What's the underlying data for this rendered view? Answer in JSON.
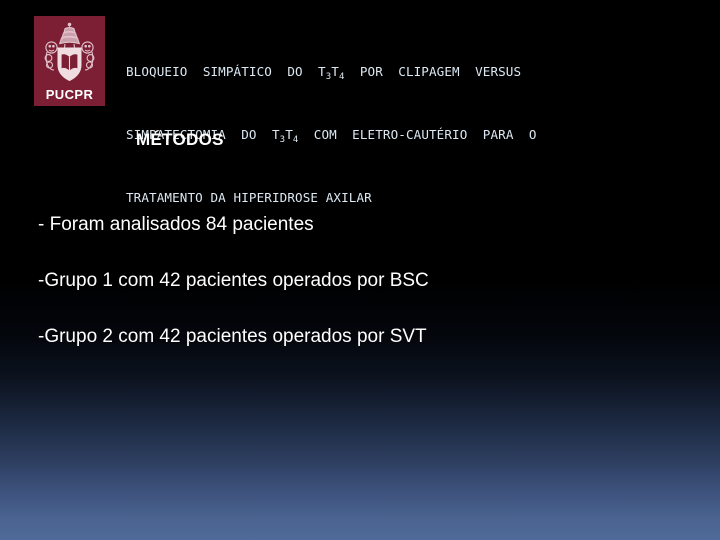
{
  "slide": {
    "background_top_color": "#000000",
    "background_bottom_color": "#506b99"
  },
  "logo": {
    "name": "PUCPR",
    "wordmark": "PUCPR",
    "background_color": "#7c1f34",
    "emblem_color": "#e8c9d2",
    "emblem_description": "papal-tiara-shield-with-book-and-lions"
  },
  "title": {
    "color": "#dce8f2",
    "line1_part1": "BLOQUEIO  SIMPÁTICO  DO  T",
    "line1_sub1": "3",
    "line1_part2": "T",
    "line1_sub2": "4",
    "line1_part3": "  POR  CLIPAGEM  VERSUS",
    "line2_part1": "SIMPATECTOMIA  DO  T",
    "line2_sub1": "3",
    "line2_part2": "T",
    "line2_sub2": "4",
    "line2_part3": "  COM  ELETRO-CAUTÉRIO  PARA  O",
    "line3": "TRATAMENTO DA HIPERIDROSE AXILAR",
    "full_text": "BLOQUEIO SIMPÁTICO DO T3T4 POR CLIPAGEM VERSUS SIMPATECTOMIA DO T3T4 COM ELETRO-CAUTÉRIO PARA O TRATAMENTO DA HIPERIDROSE AXILAR"
  },
  "section": {
    "heading": "MÉTODOS"
  },
  "content": {
    "bullets": [
      "- Foram analisados 84 pacientes",
      "-Grupo 1 com 42 pacientes operados por BSC",
      "-Grupo 2 com 42 pacientes operados por SVT"
    ]
  }
}
